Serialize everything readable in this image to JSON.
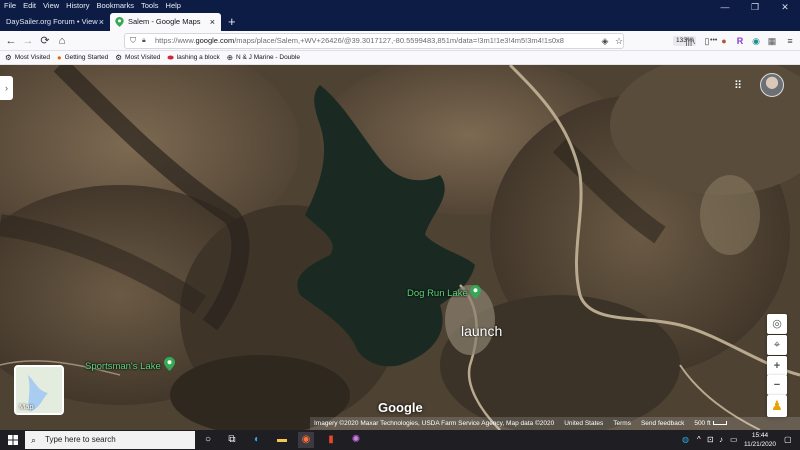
{
  "menu": [
    "File",
    "Edit",
    "View",
    "History",
    "Bookmarks",
    "Tools",
    "Help"
  ],
  "window_controls": {
    "minimize": "—",
    "maximize": "❐",
    "close": "✕"
  },
  "tabs": [
    {
      "label": "DaySailer.org Forum • View topic",
      "close": "×"
    },
    {
      "label": "Salem - Google Maps",
      "close": "×"
    }
  ],
  "new_tab_label": "+",
  "nav": {
    "back": "←",
    "forward": "→",
    "reload": "⟳",
    "home": "⌂"
  },
  "url": {
    "prefix": "https://www.",
    "domain": "google.com",
    "rest": "/maps/place/Salem,+WV+26426/@39.3017127,-80.5599483,851m/data=!3m1!1e3!4m5!3m4!1s0x8"
  },
  "zoom": "133%",
  "url_actions": {
    "more": "•••",
    "pocket": "◈",
    "star": "☆"
  },
  "toolbar_right": {
    "library": "|||\\",
    "sidebar": "▯",
    "account": "●",
    "reader": "R",
    "ext1": "◉",
    "ext2": "▦",
    "menu": "≡"
  },
  "bookmarks": [
    {
      "label": "Most Visited",
      "icon": "⚙"
    },
    {
      "label": "Getting Started",
      "icon": "●"
    },
    {
      "label": "Most Visited",
      "icon": "⚙"
    },
    {
      "label": "lashing a block",
      "icon": "⬬"
    },
    {
      "label": "N & J Marine - Double",
      "icon": "⊕"
    }
  ],
  "map": {
    "left_panel_toggle": "›",
    "apps_icon": "⠿",
    "places": [
      {
        "name": "Dog Run Lake"
      },
      {
        "name": "Sportsman's Lake"
      }
    ],
    "annotation": "launch",
    "minimap_label": "Map",
    "logo": "Google",
    "attribution": "Imagery ©2020 Maxar Technologies, USDA Farm Service Agency, Map data ©2020",
    "footer_links": [
      "United States",
      "Terms",
      "Send feedback"
    ],
    "scale": "500 ft",
    "controls": {
      "layers": "◎",
      "location": "⌖",
      "zoom_in": "+",
      "zoom_out": "−",
      "pegman": "♟"
    },
    "water_color": "#1a2a22"
  },
  "taskbar": {
    "search_placeholder": "Type here to search",
    "search_icon": "⌕",
    "time": "15:44",
    "date": "11/21/2020",
    "tray": [
      "^",
      "⊡",
      "♪",
      "▭"
    ],
    "notification": "▢"
  }
}
